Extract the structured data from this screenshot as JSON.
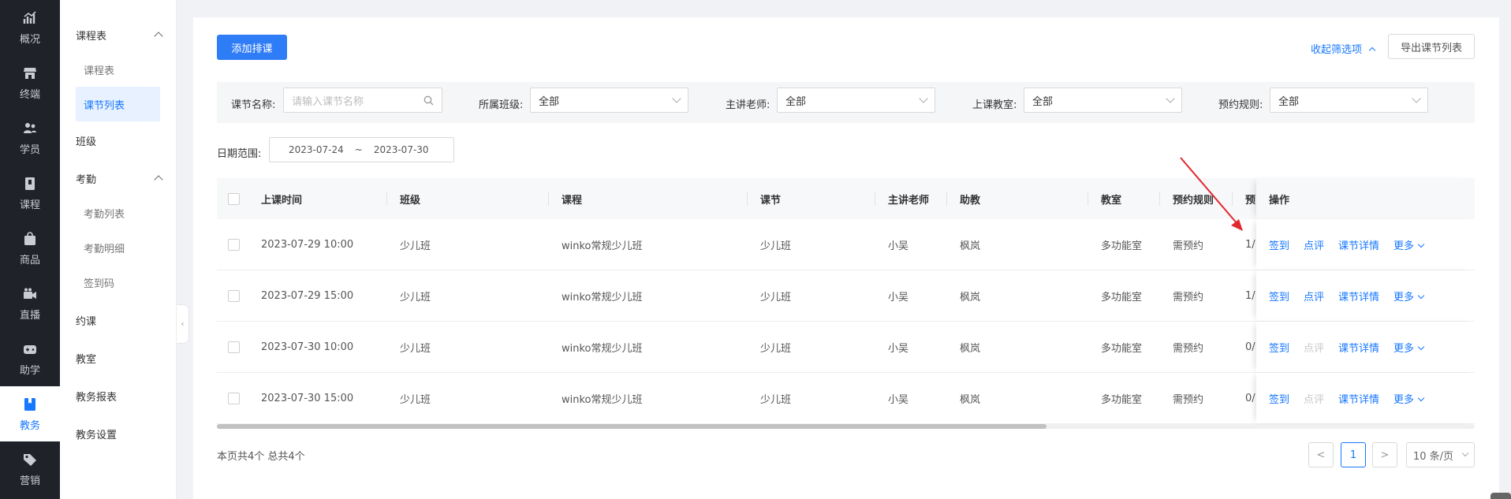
{
  "nav": [
    {
      "label": "概况",
      "icon": "chart-line-icon"
    },
    {
      "label": "终端",
      "icon": "store-icon"
    },
    {
      "label": "学员",
      "icon": "users-icon"
    },
    {
      "label": "课程",
      "icon": "book-icon"
    },
    {
      "label": "商品",
      "icon": "bag-icon"
    },
    {
      "label": "直播",
      "icon": "video-camera-icon"
    },
    {
      "label": "助学",
      "icon": "gamepad-icon"
    },
    {
      "label": "教务",
      "icon": "bookmark-icon"
    },
    {
      "label": "营销",
      "icon": "tag-icon"
    }
  ],
  "sidebar": {
    "schedule": {
      "label": "课程表",
      "subs": [
        "课程表",
        "课节列表"
      ]
    },
    "class": "班级",
    "attendance": {
      "label": "考勤",
      "subs": [
        "考勤列表",
        "考勤明细",
        "签到码"
      ]
    },
    "booking": "约课",
    "classroom": "教室",
    "report": "教务报表",
    "settings": "教务设置"
  },
  "toolbar": {
    "add_label": "添加排课",
    "collapse_label": "收起筛选项",
    "export_label": "导出课节列表"
  },
  "filters": {
    "lesson_name": {
      "label": "课节名称:",
      "placeholder": "请输入课节名称"
    },
    "class": {
      "label": "所属班级:",
      "value": "全部"
    },
    "teacher": {
      "label": "主讲老师:",
      "value": "全部"
    },
    "classroom": {
      "label": "上课教室:",
      "value": "全部"
    },
    "rule": {
      "label": "预约规则:",
      "value": "全部"
    },
    "date": {
      "label": "日期范围:",
      "start": "2023-07-24",
      "sep": "~",
      "end": "2023-07-30"
    }
  },
  "table": {
    "headers": {
      "time": "上课时间",
      "class": "班级",
      "course": "课程",
      "lesson": "课节",
      "teacher": "主讲老师",
      "assistant": "助教",
      "room": "教室",
      "rule": "预约规则",
      "extra": "预",
      "ops": "操作"
    },
    "rows": [
      {
        "time": "2023-07-29 10:00",
        "class": "少儿班",
        "course": "winko常规少儿班",
        "lesson": "少儿班",
        "teacher": "小吴",
        "assistant": "枫岚",
        "room": "多功能室",
        "rule": "需预约",
        "extra": "1/",
        "comment_disabled": false
      },
      {
        "time": "2023-07-29 15:00",
        "class": "少儿班",
        "course": "winko常规少儿班",
        "lesson": "少儿班",
        "teacher": "小吴",
        "assistant": "枫岚",
        "room": "多功能室",
        "rule": "需预约",
        "extra": "1/",
        "comment_disabled": false
      },
      {
        "time": "2023-07-30 10:00",
        "class": "少儿班",
        "course": "winko常规少儿班",
        "lesson": "少儿班",
        "teacher": "小吴",
        "assistant": "枫岚",
        "room": "多功能室",
        "rule": "需预约",
        "extra": "0/",
        "comment_disabled": true
      },
      {
        "time": "2023-07-30 15:00",
        "class": "少儿班",
        "course": "winko常规少儿班",
        "lesson": "少儿班",
        "teacher": "小吴",
        "assistant": "枫岚",
        "room": "多功能室",
        "rule": "需预约",
        "extra": "0/",
        "comment_disabled": true
      }
    ],
    "actions": {
      "checkin": "签到",
      "comment": "点评",
      "detail": "课节详情",
      "more": "更多"
    }
  },
  "footer": {
    "summary": "本页共4个 总共4个",
    "current_page": "1",
    "page_size": "10 条/页",
    "prev": "<",
    "next": ">"
  },
  "colors": {
    "primary": "#2f7df6",
    "link": "#1677ff",
    "nav_bg": "#1f2329",
    "annotation_arrow": "#e0282e"
  }
}
